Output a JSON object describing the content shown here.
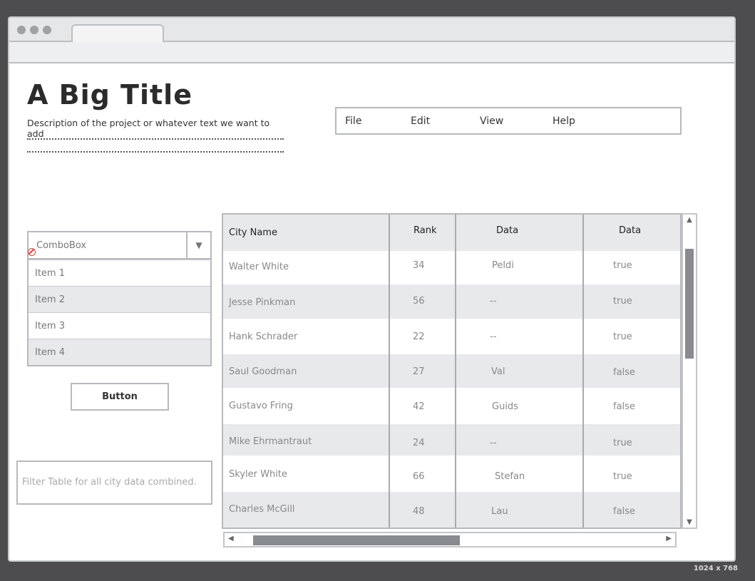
{
  "header": {
    "title": "A Big Title",
    "description": "Description of the project or whatever text we want to add"
  },
  "menu": {
    "items": [
      {
        "label": "File"
      },
      {
        "label": "Edit"
      },
      {
        "label": "View"
      },
      {
        "label": "Help"
      }
    ]
  },
  "combobox": {
    "label": "ComboBox",
    "items": [
      "Item 1",
      "Item 2",
      "Item 3",
      "Item 4"
    ]
  },
  "button": {
    "label": "Button"
  },
  "filter": {
    "placeholder": "Filter Table for all city data combined."
  },
  "table": {
    "columns": [
      "City Name",
      "Rank",
      "Data",
      "Data"
    ],
    "rows": [
      [
        "Walter White",
        "34",
        "Peldi",
        "true"
      ],
      [
        "Jesse Pinkman",
        "56",
        "--",
        "true"
      ],
      [
        "Hank Schrader",
        "22",
        "--",
        "true"
      ],
      [
        "Saul Goodman",
        "27",
        "Val",
        "false"
      ],
      [
        "Gustavo Fring",
        "42",
        "Guids",
        "false"
      ],
      [
        "Mike Ehrmantraut",
        "24",
        "--",
        "true"
      ],
      [
        "Skyler White",
        "66",
        "Stefan",
        "true"
      ],
      [
        "Charles McGill",
        "48",
        "Lau",
        "false"
      ]
    ]
  },
  "canvas_size_label": "1024 x 768",
  "colors": {
    "frame_background": "#4d4d50",
    "alt_row": "#e8e9eb",
    "border": "#b8b9bc",
    "scroll_thumb": "#888b8f"
  }
}
